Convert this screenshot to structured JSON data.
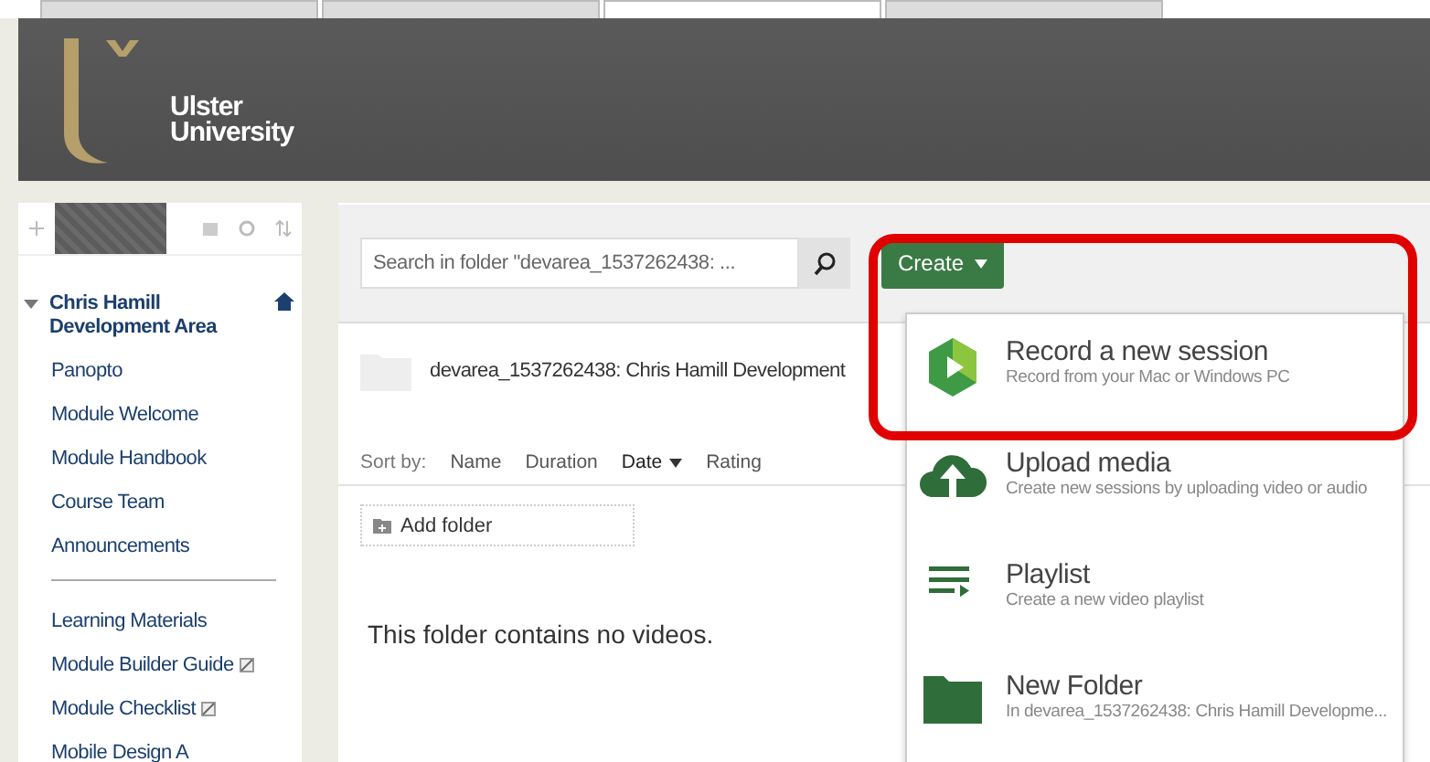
{
  "browser_tabs": [
    {
      "selected": false
    },
    {
      "selected": false
    },
    {
      "selected": true
    },
    {
      "selected": false
    }
  ],
  "header": {
    "logo_lines": [
      "Ulster",
      "University"
    ]
  },
  "sidebar": {
    "course": {
      "title": "Chris Hamill Development Area",
      "expanded": true
    },
    "groups": [
      [
        {
          "label": "Panopto",
          "edit_icon": false
        },
        {
          "label": "Module Welcome",
          "edit_icon": false
        },
        {
          "label": "Module Handbook",
          "edit_icon": false
        },
        {
          "label": "Course Team",
          "edit_icon": false
        },
        {
          "label": "Announcements",
          "edit_icon": false
        }
      ],
      [
        {
          "label": "Learning Materials",
          "edit_icon": false
        },
        {
          "label": "Module Builder Guide",
          "edit_icon": true
        },
        {
          "label": "Module Checklist",
          "edit_icon": true
        },
        {
          "label": "Mobile Design A",
          "edit_icon": false
        }
      ]
    ]
  },
  "search": {
    "placeholder": "Search in folder \"devarea_1537262438: ..."
  },
  "create_button": {
    "label": "Create"
  },
  "folder": {
    "title": "devarea_1537262438: Chris Hamill Development"
  },
  "sort": {
    "label": "Sort by:",
    "options": [
      {
        "label": "Name",
        "selected": false
      },
      {
        "label": "Duration",
        "selected": false
      },
      {
        "label": "Date",
        "selected": true
      },
      {
        "label": "Rating",
        "selected": false
      }
    ]
  },
  "add_folder": {
    "label": "Add folder"
  },
  "empty_message": "This folder contains no videos.",
  "create_menu": [
    {
      "kind": "record",
      "title": "Record a new session",
      "subtitle": "Record from your Mac or Windows PC",
      "highlighted": true
    },
    {
      "kind": "upload",
      "title": "Upload media",
      "subtitle": "Create new sessions by uploading video or audio",
      "highlighted": false
    },
    {
      "kind": "playlist",
      "title": "Playlist",
      "subtitle": "Create a new video playlist",
      "highlighted": false
    },
    {
      "kind": "folder",
      "title": "New Folder",
      "subtitle": "In devarea_1537262438: Chris Hamill Developme...",
      "highlighted": false
    }
  ]
}
